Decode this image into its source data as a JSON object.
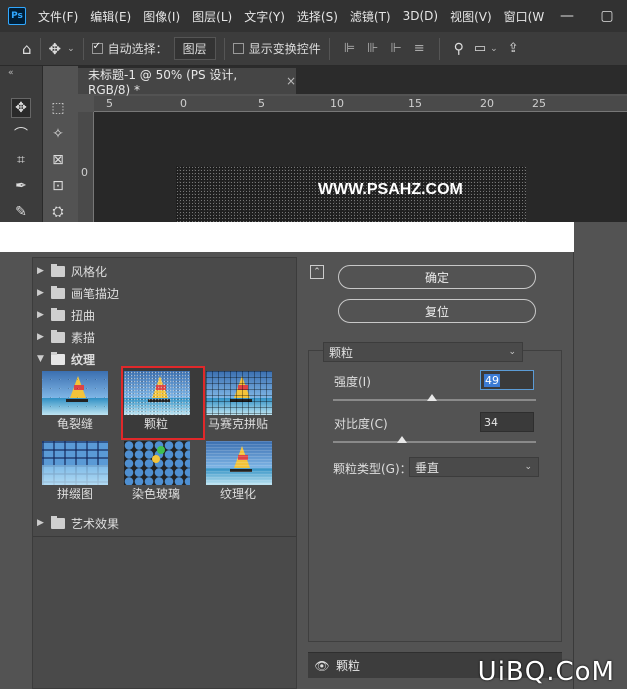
{
  "menubar": {
    "logo": "Ps",
    "items": [
      "文件(F)",
      "编辑(E)",
      "图像(I)",
      "图层(L)",
      "文字(Y)",
      "选择(S)",
      "滤镜(T)",
      "3D(D)",
      "视图(V)",
      "窗口(W"
    ],
    "minimize": "—",
    "restore": "▢"
  },
  "options": {
    "auto_select_label": "自动选择：",
    "auto_select_value": "图层",
    "show_transform_label": "显示变换控件"
  },
  "document": {
    "tab_title": "未标题-1 @ 50% (PS 设计, RGB/8) *",
    "close": "×",
    "ruler_top_ticks": [
      "5",
      "0",
      "5",
      "10",
      "15",
      "20",
      "25"
    ],
    "ruler_left_ticks": [
      "0"
    ],
    "canvas_text": "WWW.PSAHZ.COM"
  },
  "gallery": {
    "folders_top": [
      "风格化",
      "画笔描边",
      "扭曲",
      "素描"
    ],
    "open_folder": "纹理",
    "thumbs": [
      {
        "label": "龟裂缝"
      },
      {
        "label": "颗粒"
      },
      {
        "label": "马赛克拼贴"
      },
      {
        "label": "拼缀图"
      },
      {
        "label": "染色玻璃"
      },
      {
        "label": "纹理化"
      }
    ],
    "folders_bottom": [
      "艺术效果"
    ]
  },
  "panel": {
    "ok_label": "确定",
    "reset_label": "复位",
    "filter_name": "颗粒",
    "intensity_label": "强度(I)",
    "intensity_value": "49",
    "contrast_label": "对比度(C)",
    "contrast_value": "34",
    "grain_type_label": "颗粒类型(G)：",
    "grain_type_value": "垂直",
    "layer_name": "颗粒",
    "intensity_fraction": 0.49,
    "contrast_fraction": 0.34
  },
  "watermark_site": "UiBQ.CoM"
}
